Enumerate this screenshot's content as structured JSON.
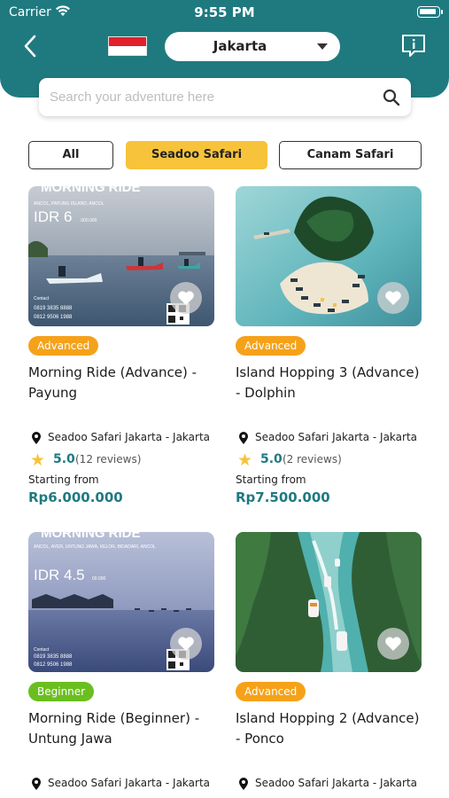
{
  "status_bar": {
    "carrier": "Carrier",
    "time": "9:55 PM"
  },
  "header": {
    "city": "Jakarta",
    "search_placeholder": "Search your adventure here",
    "brand_color": "#1f7a80"
  },
  "tabs": [
    {
      "label": "All",
      "active": false
    },
    {
      "label": "Seadoo Safari",
      "active": true
    },
    {
      "label": "Canam Safari",
      "active": false
    }
  ],
  "cards": [
    {
      "badge": "Advanced",
      "title": "Morning Ride (Advance) - Payung",
      "location": "Seadoo Safari Jakarta - Jakarta",
      "rating": "5.0",
      "reviews": "(12 reviews)",
      "starting_from": "Starting from",
      "price": "Rp6.000.000",
      "poster": {
        "brand": "MORNING RIDE",
        "route": "ANCOL, PAYUNG ISLAND, ANCOL",
        "price": "IDR 6",
        "price_suffix": ".000.000",
        "contact_label": "Contact",
        "phones": [
          "0819 3835 8888",
          "0812 9506 1988"
        ]
      }
    },
    {
      "badge": "Advanced",
      "title": "Island Hopping 3 (Advance) - Dolphin",
      "location": "Seadoo Safari Jakarta - Jakarta",
      "rating": "5.0",
      "reviews": "(2 reviews)",
      "starting_from": "Starting from",
      "price": "Rp7.500.000"
    },
    {
      "badge": "Beginner",
      "title": "Morning Ride (Beginner) - Untung Jawa",
      "location": "Seadoo Safari Jakarta - Jakarta",
      "poster": {
        "brand": "MORNING RIDE",
        "route": "ANCOL, AYER, UNTUNG JAWA, KELOR, BIDADARI, ANCOL",
        "price": "IDR 4.5",
        "price_suffix": "00.000",
        "contact_label": "Contact",
        "phones": [
          "0819 3835 8888",
          "0812 9506 1988"
        ]
      }
    },
    {
      "badge": "Advanced",
      "title": "Island Hopping 2 (Advance) - Ponco",
      "location": "Seadoo Safari Jakarta - Jakarta"
    }
  ]
}
